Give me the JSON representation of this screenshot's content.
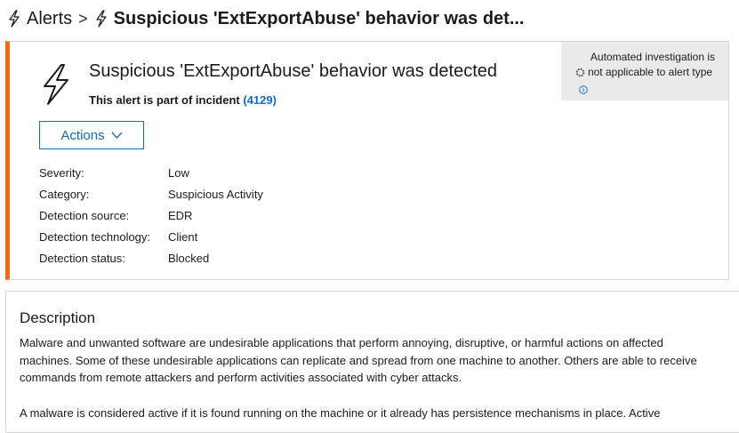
{
  "breadcrumb": {
    "root_label": "Alerts",
    "separator": ">",
    "current_label": "Suspicious 'ExtExportAbuse' behavior was det..."
  },
  "alert": {
    "title": "Suspicious 'ExtExportAbuse' behavior was detected",
    "incident_prefix": "This alert is part of incident",
    "incident_link": "(4129)",
    "actions_label": "Actions",
    "accent_color": "#ea6c17",
    "details": [
      {
        "key": "Severity:",
        "value": "Low"
      },
      {
        "key": "Category:",
        "value": "Suspicious Activity"
      },
      {
        "key": "Detection source:",
        "value": "EDR"
      },
      {
        "key": "Detection technology:",
        "value": "Client"
      },
      {
        "key": "Detection status:",
        "value": "Blocked"
      }
    ]
  },
  "automated_investigation": {
    "line1": "Automated investigation is",
    "line2": "not applicable to alert type"
  },
  "description": {
    "title": "Description",
    "paragraph1": "Malware and unwanted software are undesirable applications that perform annoying, disruptive, or harmful actions on affected machines. Some of these undesirable applications can replicate and spread from one machine to another. Others are able to receive commands from remote attackers and perform activities associated with cyber attacks.",
    "paragraph2": "A malware is considered active if it is found running on the machine or it already has persistence mechanisms in place. Active"
  },
  "icons": {
    "breadcrumb": "lightning-bolt-icon",
    "alert": "lightning-bolt-icon",
    "actions": "chevron-down-icon",
    "automation": "gear-icon",
    "info": "info-icon"
  },
  "colors": {
    "link": "#0f6cbd",
    "panel_bg": "#eaeaea"
  }
}
